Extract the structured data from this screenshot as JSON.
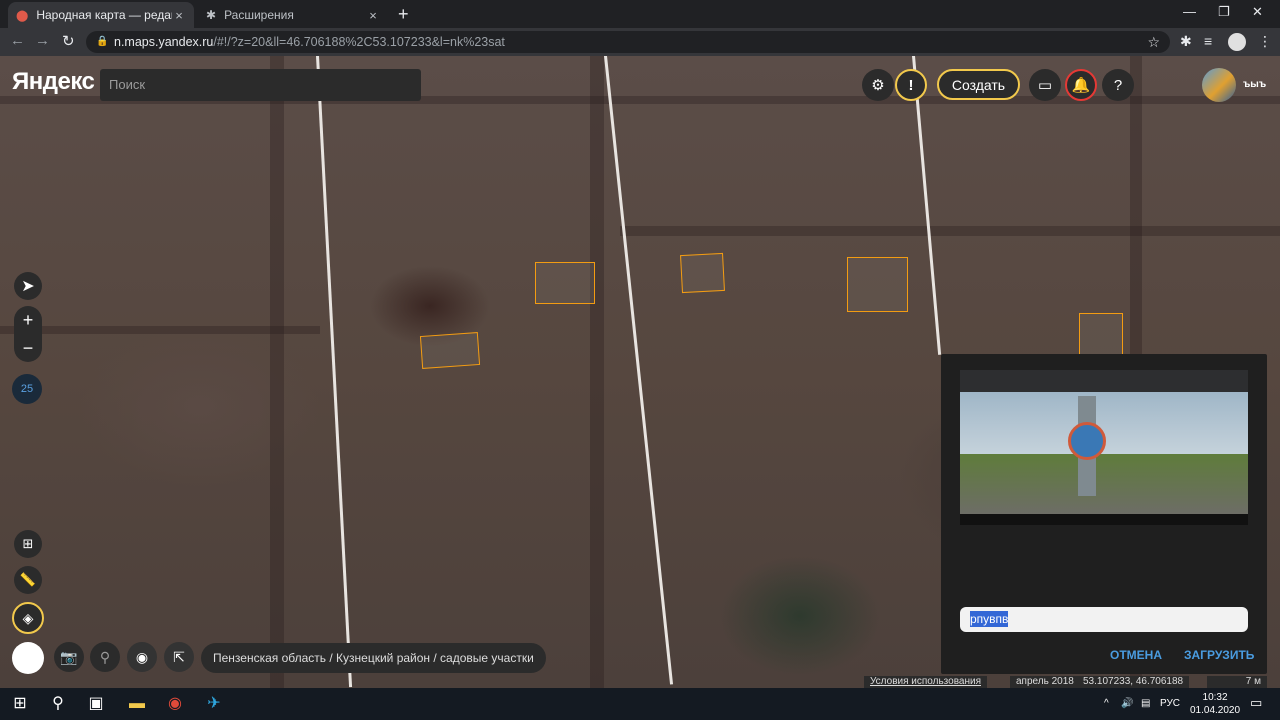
{
  "browser": {
    "tabs": [
      {
        "title": "Народная карта — редактор Ян",
        "close": "×"
      },
      {
        "title": "Расширения",
        "close": "×"
      }
    ],
    "new_tab": "+",
    "url_main": "n.maps.yandex.ru",
    "url_rest": "/#!/?z=20&ll=46.706188%2C53.107233&l=nk%23sat"
  },
  "app": {
    "logo": "Яндекс",
    "search_placeholder": "Поиск",
    "create_label": "Создать",
    "help_label": "?",
    "alert_label": "!",
    "username": "ъыъ",
    "zoom_plus": "+",
    "zoom_minus": "−",
    "zoom_level": "25",
    "breadcrumb": "Пензенская область / Кузнецкий район / садовые участки"
  },
  "dialog": {
    "input_value": "рпувпв",
    "cancel_label": "ОТМЕНА",
    "upload_label": "ЗАГРУЗИТЬ"
  },
  "footer": {
    "terms": "Условия использования",
    "date": "апрель 2018",
    "coords": "53.107233, 46.706188",
    "scale": "7 м"
  },
  "taskbar": {
    "lang": "РУС",
    "time": "10:32",
    "date": "01.04.2020"
  },
  "colors": {
    "accent": "#f2c94c",
    "building_outline": "#f39c12",
    "link": "#4a9ce0"
  }
}
